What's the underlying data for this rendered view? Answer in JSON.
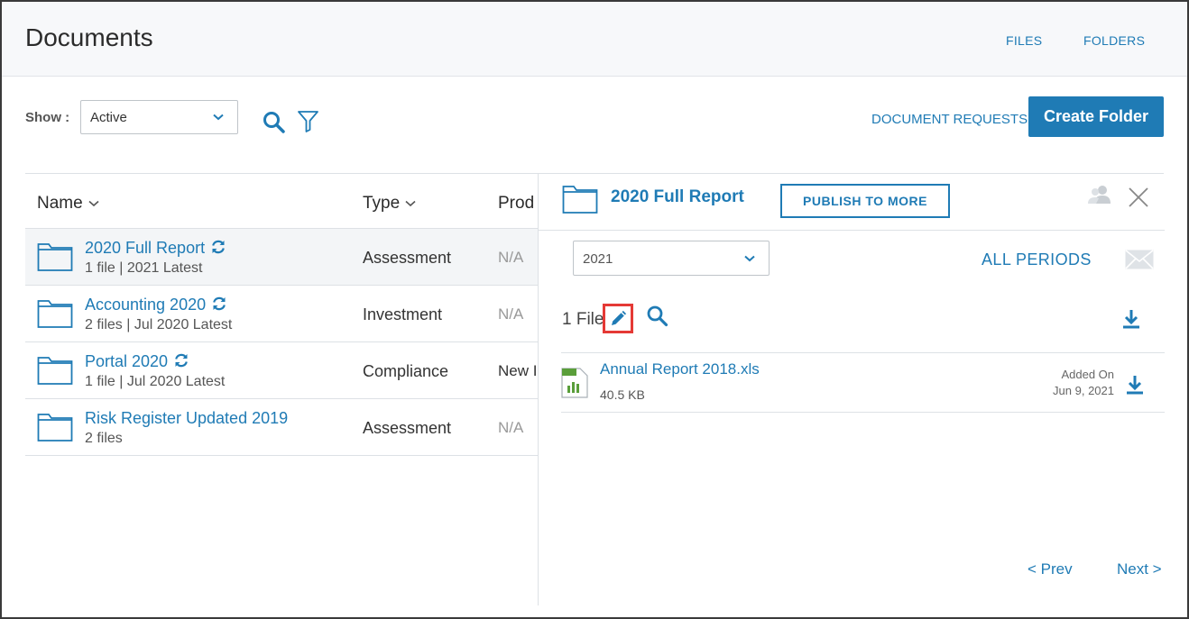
{
  "header": {
    "title": "Documents",
    "tabs": [
      {
        "label": "FILES"
      },
      {
        "label": "FOLDERS"
      }
    ]
  },
  "filter": {
    "show_label": "Show :",
    "status_value": "Active"
  },
  "actions": {
    "document_requests_label": "DOCUMENT REQUESTS",
    "create_folder_label": "Create Folder"
  },
  "table": {
    "columns": [
      {
        "label": "Name"
      },
      {
        "label": "Type"
      },
      {
        "label": "Prod"
      }
    ],
    "rows": [
      {
        "name": "2020 Full Report",
        "sub": "1 file | 2021 Latest",
        "type": "Assessment",
        "prod": "N/A",
        "synced": true,
        "selected": true
      },
      {
        "name": "Accounting 2020",
        "sub": "2 files | Jul 2020 Latest",
        "type": "Investment",
        "prod": "N/A",
        "synced": true,
        "selected": false
      },
      {
        "name": "Portal 2020",
        "sub": "1 file | Jul 2020 Latest",
        "type": "Compliance",
        "prod": "New I",
        "synced": true,
        "selected": false
      },
      {
        "name": "Risk Register Updated 2019",
        "sub": "2 files",
        "type": "Assessment",
        "prod": "N/A",
        "synced": false,
        "selected": false
      }
    ]
  },
  "panel": {
    "title": "2020 Full Report",
    "publish_label": "PUBLISH TO MORE",
    "period_value": "2021",
    "all_periods_label": "ALL PERIODS",
    "file_count": "1 File",
    "files": [
      {
        "name": "Annual Report 2018.xls",
        "size": "40.5 KB",
        "added_label": "Added On",
        "added_date": "Jun 9, 2021",
        "icon_tag": "XLS"
      }
    ],
    "prev_label": "< Prev",
    "next_label": "Next >"
  },
  "colors": {
    "accent": "#1f7bb5",
    "highlight": "#e53935",
    "excel_green": "#5a9e3a"
  }
}
